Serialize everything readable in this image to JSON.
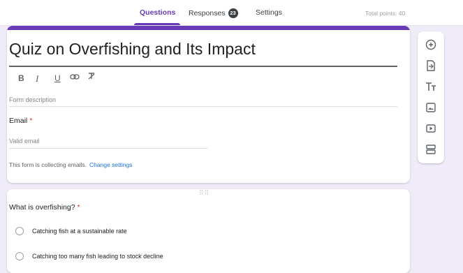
{
  "tabs": [
    {
      "label": "Questions"
    },
    {
      "label": "Responses",
      "badge": "23"
    },
    {
      "label": "Settings"
    }
  ],
  "total_points": "Total points: 40",
  "form": {
    "title": "Quiz on Overfishing and Its Impact",
    "format_tools": {
      "bold": "B",
      "italic": "I",
      "underline": "U",
      "link": "link-icon",
      "clear": "clear-format-icon"
    },
    "description_placeholder": "Form description",
    "email_label": "Email",
    "required_mark": "*",
    "email_placeholder": "Valid email",
    "collecting_text": "This form is collecting emails.",
    "change_settings_link": "Change settings"
  },
  "question": {
    "title": "What is overfishing?",
    "required_mark": "*",
    "options": [
      {
        "label": "Catching fish at a sustainable rate"
      },
      {
        "label": "Catching too many fish leading to stock decline"
      }
    ]
  },
  "toolbar_icons": [
    "add-question-icon",
    "import-questions-icon",
    "add-title-icon",
    "add-image-icon",
    "add-video-icon",
    "add-section-icon"
  ],
  "colors": {
    "accent": "#673ab7",
    "background": "#f0ebf8",
    "link": "#1a73e8",
    "required": "#d93025"
  }
}
